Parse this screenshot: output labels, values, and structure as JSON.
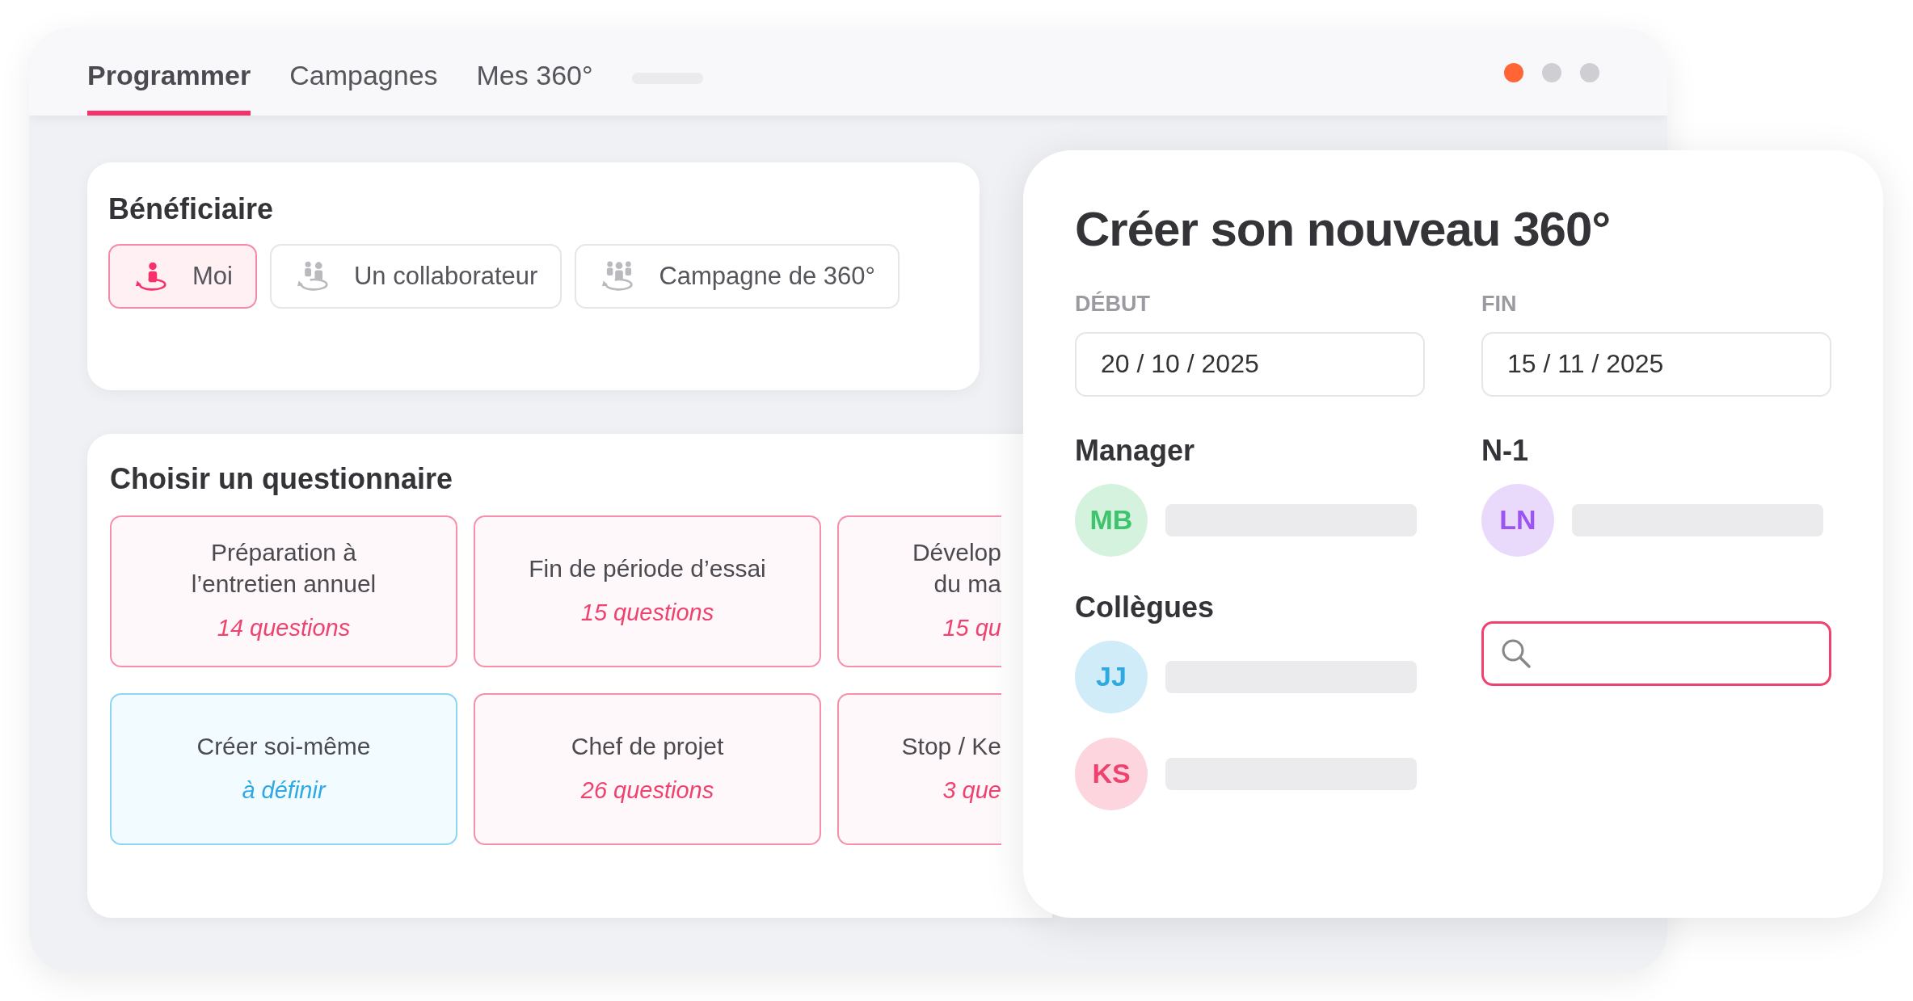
{
  "tabs": [
    {
      "label": "Programmer",
      "selected": true
    },
    {
      "label": "Campagnes",
      "selected": false
    },
    {
      "label": "Mes 360°",
      "selected": false
    }
  ],
  "beneficiary": {
    "title": "Bénéficiaire",
    "options": [
      {
        "label": "Moi",
        "selected": true,
        "kind": "single"
      },
      {
        "label": "Un collaborateur",
        "selected": false,
        "kind": "pair"
      },
      {
        "label": "Campagne de 360°",
        "selected": false,
        "kind": "group"
      }
    ]
  },
  "questionnaire": {
    "title": "Choisir un questionnaire",
    "items": [
      {
        "title": "Préparation à\nl’entretien annuel",
        "subtitle": "14 questions",
        "kind": "template"
      },
      {
        "title": "Fin de période d’essai",
        "subtitle": "15 questions",
        "kind": "template"
      },
      {
        "title": "Dévelop\ndu ma",
        "subtitle": "15 qu",
        "kind": "template"
      },
      {
        "title": "Créer soi-même",
        "subtitle": "à définir",
        "kind": "custom"
      },
      {
        "title": "Chef de projet",
        "subtitle": "26 questions",
        "kind": "template"
      },
      {
        "title": "Stop / Ke",
        "subtitle": "3 que",
        "kind": "template"
      }
    ]
  },
  "create": {
    "title": "Créer son nouveau 360°",
    "start": {
      "label": "DÉBUT",
      "value": "20 / 10 / 2025"
    },
    "end": {
      "label": "FIN",
      "value": "15 / 11 / 2025"
    },
    "manager": {
      "title": "Manager",
      "people": [
        {
          "initials": "MB",
          "color": "#3ec46d"
        }
      ]
    },
    "n1": {
      "title": "N-1",
      "people": [
        {
          "initials": "LN",
          "color": "#9d55f2"
        }
      ]
    },
    "colleagues": {
      "title": "Collègues",
      "people": [
        {
          "initials": "JJ",
          "color": "#2ea9e2"
        },
        {
          "initials": "KS",
          "color": "#f0426e"
        }
      ],
      "search": {
        "focused": true
      }
    }
  }
}
